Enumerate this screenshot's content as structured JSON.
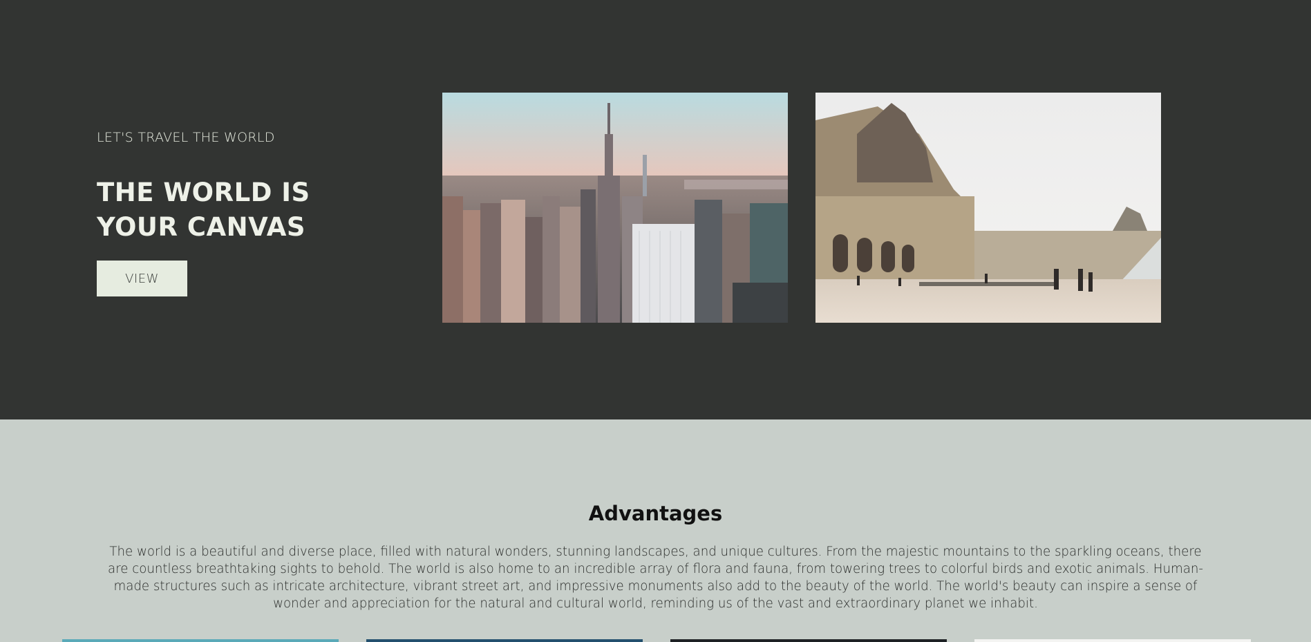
{
  "hero": {
    "tagline": "LET'S TRAVEL THE WORLD",
    "title": "THE WORLD IS YOUR CANVAS",
    "view_label": "VIEW",
    "images": [
      {
        "name": "new-york-skyline-photo"
      },
      {
        "name": "louvre-palace-photo"
      }
    ]
  },
  "advantages": {
    "title": "Advantages",
    "text": "The world is a beautiful and diverse place, filled with natural wonders, stunning landscapes, and unique cultures. From the majestic mountains to the sparkling oceans, there are countless breathtaking sights to behold. The world is also home to an incredible array of flora and fauna, from towering trees to colorful birds and exotic animals. Human-made structures such as intricate architecture, vibrant street art, and impressive monuments also add to the beauty of the world. The world's beauty can inspire a sense of wonder and appreciation for the natural and cultural world, reminding us of the vast and extraordinary planet we inhabit."
  },
  "colors": {
    "hero_bg": "#323432",
    "section_bg": "#c8cfca",
    "button_bg": "#e6ece0"
  }
}
